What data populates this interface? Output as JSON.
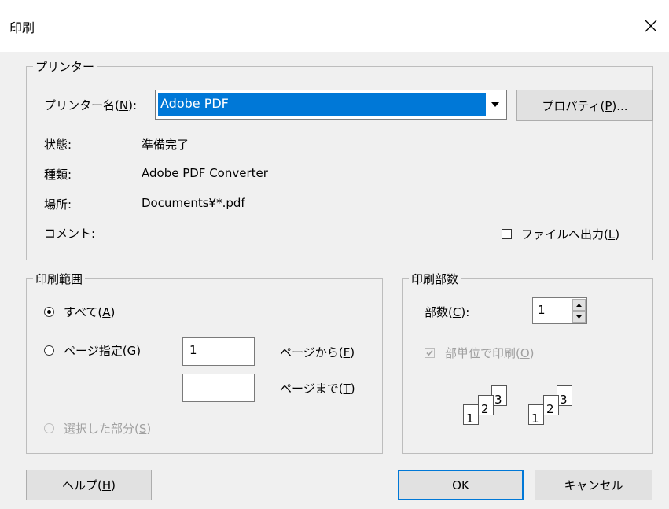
{
  "window": {
    "title": "印刷"
  },
  "printer_group": {
    "legend": "プリンター",
    "name_label": "プリンター名(",
    "name_key": "N",
    "name_suffix": "):",
    "selected_printer": "Adobe PDF",
    "properties_label": "プロパティ(",
    "properties_key": "P",
    "properties_suffix": ")...",
    "status_label": "状態:",
    "status_value": "準備完了",
    "type_label": "種類:",
    "type_value": "Adobe PDF Converter",
    "location_label": "場所:",
    "location_value": "Documents¥*.pdf",
    "comment_label": "コメント:",
    "print_to_file_label": "ファイルへ出力(",
    "print_to_file_key": "L",
    "print_to_file_suffix": ")",
    "print_to_file_checked": false
  },
  "range_group": {
    "legend": "印刷範囲",
    "all_label": "すべて(",
    "all_key": "A",
    "all_suffix": ")",
    "pages_label": "ページ指定(",
    "pages_key": "G",
    "pages_suffix": ")",
    "from_value": "1",
    "from_label": "ページから(",
    "from_key": "F",
    "from_suffix": ")",
    "to_value": "",
    "to_label": "ページまで(",
    "to_key": "T",
    "to_suffix": ")",
    "selection_label": "選択した部分(",
    "selection_key": "S",
    "selection_suffix": ")",
    "selected_option": "all"
  },
  "copies_group": {
    "legend": "印刷部数",
    "copies_label": "部数(",
    "copies_key": "C",
    "copies_suffix": "):",
    "copies_value": "1",
    "collate_label": "部単位で印刷(",
    "collate_key": "O",
    "collate_suffix": ")",
    "collate_checked": true,
    "collate_enabled": false,
    "page_numbers": [
      "1",
      "2",
      "3",
      "1",
      "2",
      "3"
    ]
  },
  "buttons": {
    "help_label": "ヘルプ(",
    "help_key": "H",
    "help_suffix": ")",
    "ok_label": "OK",
    "cancel_label": "キャンセル"
  },
  "colors": {
    "accent": "#0078d7",
    "background": "#f0f0f0",
    "disabled_text": "#a0a0a0"
  }
}
